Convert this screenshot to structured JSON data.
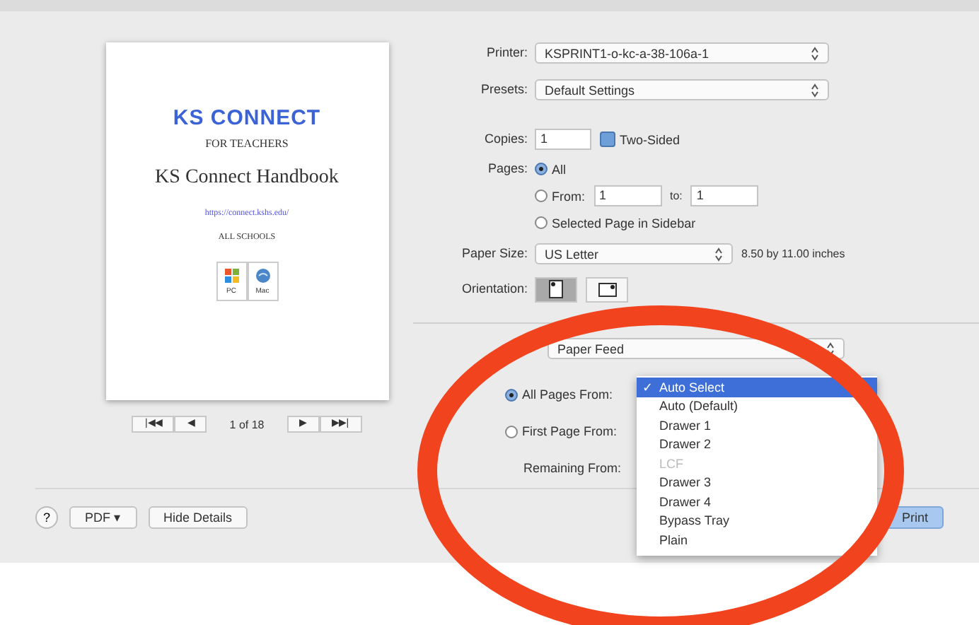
{
  "preview": {
    "logo": "KS CONNECT",
    "subtitle": "FOR TEACHERS",
    "title": "KS Connect Handbook",
    "url": "https://connect.kshs.edu/",
    "audience": "ALL SCHOOLS",
    "badges": [
      "PC",
      "Mac"
    ]
  },
  "pager": {
    "first": "|◀◀",
    "prev": "◀",
    "position": "1 of 18",
    "next": "▶",
    "last": "▶▶|"
  },
  "printer": {
    "label": "Printer:",
    "value": "KSPRINT1-o-kc-a-38-106a-1"
  },
  "presets": {
    "label": "Presets:",
    "value": "Default Settings"
  },
  "copies": {
    "label": "Copies:",
    "value": "1",
    "two_sided": {
      "label": "Two-Sided",
      "checked": true
    }
  },
  "pages": {
    "label": "Pages:",
    "options": [
      {
        "kind": "plain",
        "label": "All",
        "selected": true
      },
      {
        "kind": "range",
        "label": "From:",
        "from": "1",
        "to_label": "to:",
        "to": "1",
        "selected": false
      },
      {
        "kind": "plain",
        "label": "Selected Page in Sidebar",
        "selected": false
      }
    ]
  },
  "paper_size": {
    "label": "Paper Size:",
    "value": "US Letter",
    "dimensions": "8.50 by 11.00 inches"
  },
  "orientation": {
    "label": "Orientation:",
    "options": [
      {
        "kind": "portrait",
        "selected": true
      },
      {
        "kind": "landscape",
        "selected": false
      }
    ]
  },
  "section": {
    "value": "Paper Feed"
  },
  "feed": [
    {
      "kind": "radio",
      "label": "All Pages From:",
      "selected": true
    },
    {
      "kind": "radio",
      "label": "First Page From:",
      "selected": false
    },
    {
      "kind": "label",
      "label": "Remaining From:"
    }
  ],
  "feed_menu": [
    {
      "label": "Auto Select",
      "selected": true,
      "disabled": false
    },
    {
      "label": "Auto (Default)",
      "selected": false,
      "disabled": false
    },
    {
      "label": "Drawer 1",
      "selected": false,
      "disabled": false
    },
    {
      "label": "Drawer 2",
      "selected": false,
      "disabled": false
    },
    {
      "label": "LCF",
      "selected": false,
      "disabled": true
    },
    {
      "label": "Drawer 3",
      "selected": false,
      "disabled": false
    },
    {
      "label": "Drawer 4",
      "selected": false,
      "disabled": false
    },
    {
      "label": "Bypass Tray",
      "selected": false,
      "disabled": false
    },
    {
      "label": "Plain",
      "selected": false,
      "disabled": false
    }
  ],
  "check_mark": "✓",
  "footer": {
    "help": "?",
    "pdf": "PDF ▾",
    "hide_details": "Hide Details",
    "print": "Print"
  },
  "annotation": {
    "kind": "ellipse",
    "color": "#f2431f"
  }
}
